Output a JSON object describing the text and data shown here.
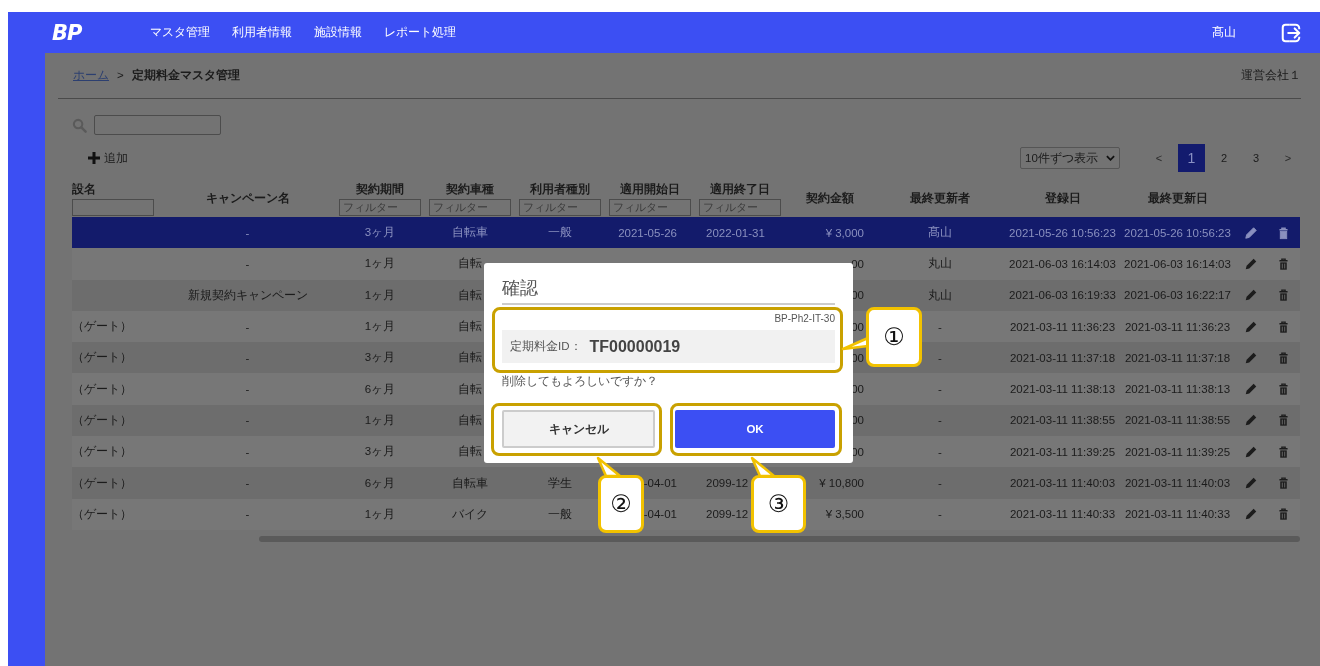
{
  "header": {
    "logo": "BP",
    "nav": [
      "マスタ管理",
      "利用者情報",
      "施設情報",
      "レポート処理"
    ],
    "user": "髙山"
  },
  "breadcrumb": {
    "home": "ホーム",
    "separator": ">",
    "current": "定期料金マスタ管理",
    "company": "運営会社１"
  },
  "toolbar": {
    "add_label": "追加",
    "per_page": "10件ずつ表示",
    "pagination": {
      "prev": "<",
      "next": ">",
      "pages": [
        {
          "label": "1",
          "selected": true
        },
        {
          "label": "2",
          "selected": false
        },
        {
          "label": "3",
          "selected": false
        }
      ]
    }
  },
  "table": {
    "columns": [
      {
        "label": "設名",
        "filter": true
      },
      {
        "label": "キャンペーン名",
        "filter": false
      },
      {
        "label": "契約期間",
        "filter": true,
        "placeholder": "フィルター"
      },
      {
        "label": "契約車種",
        "filter": true,
        "placeholder": "フィルター"
      },
      {
        "label": "利用者種別",
        "filter": true,
        "placeholder": "フィルター"
      },
      {
        "label": "適用開始日",
        "filter": true,
        "placeholder": "フィルター"
      },
      {
        "label": "適用終了日",
        "filter": true,
        "placeholder": "フィルター"
      },
      {
        "label": "契約金額",
        "filter": false
      },
      {
        "label": "最終更新者",
        "filter": false
      },
      {
        "label": "登録日",
        "filter": false
      },
      {
        "label": "最終更新日",
        "filter": false
      }
    ],
    "rows": [
      {
        "selected": true,
        "cells": [
          null,
          "-",
          "3ヶ月",
          "自転車",
          "一般",
          "2021-05-26",
          "2022-01-31",
          "¥ 3,000",
          "髙山",
          "2021-05-26 10:56:23",
          "2021-05-26 10:56:23"
        ]
      },
      {
        "selected": false,
        "cells": [
          null,
          "-",
          "1ヶ月",
          "自転",
          null,
          null,
          null,
          "00",
          "丸山",
          "2021-06-03 16:14:03",
          "2021-06-03 16:14:03"
        ]
      },
      {
        "selected": false,
        "cells": [
          null,
          "新規契約キャンペーン",
          "1ヶ月",
          "自転",
          null,
          null,
          null,
          "00",
          "丸山",
          "2021-06-03 16:19:33",
          "2021-06-03 16:22:17"
        ]
      },
      {
        "selected": false,
        "cells": [
          "（ゲート）",
          "-",
          "1ヶ月",
          "自転",
          null,
          null,
          null,
          "00",
          "-",
          "2021-03-11 11:36:23",
          "2021-03-11 11:36:23"
        ]
      },
      {
        "selected": false,
        "cells": [
          "（ゲート）",
          "-",
          "3ヶ月",
          "自転",
          null,
          null,
          null,
          "00",
          "-",
          "2021-03-11 11:37:18",
          "2021-03-11 11:37:18"
        ]
      },
      {
        "selected": false,
        "cells": [
          "（ゲート）",
          "-",
          "6ヶ月",
          "自転",
          null,
          null,
          null,
          "00",
          "-",
          "2021-03-11 11:38:13",
          "2021-03-11 11:38:13"
        ]
      },
      {
        "selected": false,
        "cells": [
          "（ゲート）",
          "-",
          "1ヶ月",
          "自転",
          null,
          null,
          null,
          "00",
          "-",
          "2021-03-11 11:38:55",
          "2021-03-11 11:38:55"
        ]
      },
      {
        "selected": false,
        "cells": [
          "（ゲート）",
          "-",
          "3ヶ月",
          "自転",
          null,
          null,
          null,
          "00",
          "-",
          "2021-03-11 11:39:25",
          "2021-03-11 11:39:25"
        ]
      },
      {
        "selected": false,
        "cells": [
          "（ゲート）",
          "-",
          "6ヶ月",
          "自転車",
          "学生",
          "-04-01",
          "2099-12",
          "¥ 10,800",
          "-",
          "2021-03-11 11:40:03",
          "2021-03-11 11:40:03"
        ]
      },
      {
        "selected": false,
        "cells": [
          "（ゲート）",
          "-",
          "1ヶ月",
          "バイク",
          "一般",
          "-04-01",
          "2099-12",
          "¥ 3,500",
          "-",
          "2021-03-11 11:40:33",
          "2021-03-11 11:40:33"
        ]
      }
    ]
  },
  "dialog": {
    "title": "確認",
    "screen_code": "BP-Ph2-IT-30",
    "id_label": "定期料金ID：",
    "id_value": "TF00000019",
    "message": "削除してもよろしいですか？",
    "buttons": [
      {
        "kind": "cancel",
        "label": "キャンセル"
      },
      {
        "kind": "ok",
        "label": "OK"
      }
    ]
  },
  "annotations": [
    {
      "label": "①"
    },
    {
      "label": "②"
    },
    {
      "label": "③"
    }
  ]
}
